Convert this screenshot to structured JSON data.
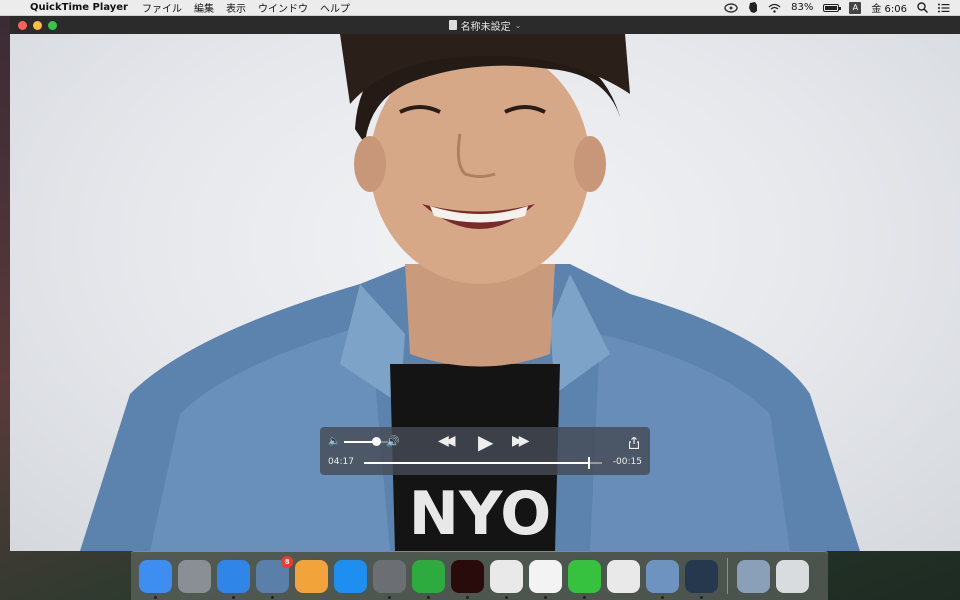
{
  "menubar": {
    "apple_icon": "apple-logo",
    "app_name": "QuickTime Player",
    "menus": [
      "ファイル",
      "編集",
      "表示",
      "ウインドウ",
      "ヘルプ"
    ],
    "battery_percent": "83%",
    "battery_level": 0.83,
    "input_source": "A",
    "clock": "金 6:06",
    "status_icons": [
      "creative-cloud-icon",
      "evernote-icon",
      "wifi-icon",
      "search-icon",
      "list-icon"
    ]
  },
  "window": {
    "title": "名称未設定",
    "title_chevron": "⌄"
  },
  "controls": {
    "volume_level": 0.72,
    "elapsed": "04:17",
    "remaining": "-00:15",
    "progress": 0.945
  },
  "dock": {
    "items": [
      {
        "name": "finder",
        "color": "#3d8ef0",
        "label": "",
        "running": true
      },
      {
        "name": "launchpad",
        "color": "#8a8f96",
        "label": "",
        "running": false
      },
      {
        "name": "safari",
        "color": "#2f86e8",
        "label": "",
        "running": true
      },
      {
        "name": "mail",
        "color": "#5a7fa8",
        "label": "",
        "running": true,
        "badge": "8"
      },
      {
        "name": "pages",
        "color": "#f2a33a",
        "label": "",
        "running": false
      },
      {
        "name": "app-store",
        "color": "#1d8ff0",
        "label": "",
        "running": false
      },
      {
        "name": "system-preferences",
        "color": "#6b6f74",
        "label": "",
        "running": true
      },
      {
        "name": "evernote",
        "color": "#2dab3f",
        "label": "",
        "running": true
      },
      {
        "name": "acrobat",
        "color": "#2a0b0b",
        "label": "",
        "running": true
      },
      {
        "name": "chrome",
        "color": "#e9e9e9",
        "label": "",
        "running": true
      },
      {
        "name": "itunes",
        "color": "#f3f3f3",
        "label": "",
        "running": true
      },
      {
        "name": "line",
        "color": "#36c23f",
        "label": "",
        "running": true
      },
      {
        "name": "chrome-2",
        "color": "#e9e9e9",
        "label": "",
        "running": false
      },
      {
        "name": "preview",
        "color": "#6f93c0",
        "label": "",
        "running": true
      },
      {
        "name": "quicktime",
        "color": "#25384d",
        "label": "",
        "running": true
      }
    ],
    "recent": {
      "name": "photo-folder",
      "color": "#8aa0b8"
    },
    "trash": {
      "name": "trash",
      "color": "#d8dcdf"
    }
  }
}
